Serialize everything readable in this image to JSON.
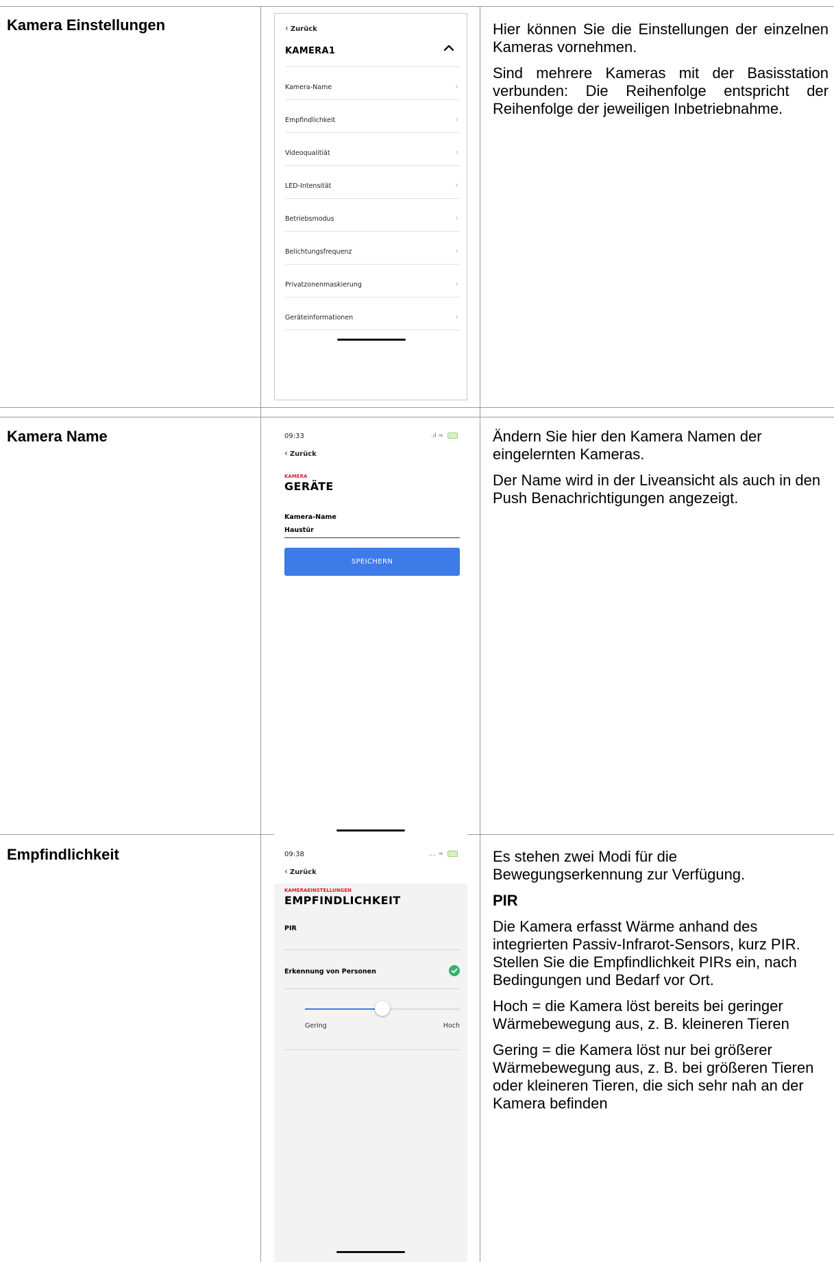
{
  "rows": [
    {
      "feature": "Kamera Einstellungen",
      "description": [
        "Hier können Sie die Einstellungen der einzelnen Kameras vornehmen.",
        "Sind mehrere Kameras mit der Basisstation verbunden: Die Reihenfolge entspricht der Reihenfolge der jeweiligen Inbetriebnahme."
      ],
      "screen": {
        "back_label": "Zurück",
        "title": "KAMERA1",
        "items": [
          "Kamera-Name",
          "Empfindlichkeit",
          "Videoqualitiät",
          "LED-Intensität",
          "Betriebsmodus",
          "Belichtungsfrequenz",
          "Privatzonenmaskierung",
          "Geräteinformationen"
        ]
      }
    },
    {
      "feature": "Kamera Name",
      "description": [
        "Ändern Sie hier den Kamera Namen der eingelernten Kameras.",
        "Der Name wird in der Liveansicht als auch in den Push Benachrichtigungen angezeigt."
      ],
      "screen": {
        "time": "09:33",
        "back_label": "Zurück",
        "kicker": "KAMERA",
        "title": "GERÄTE",
        "field_label": "Kamera-Name",
        "field_value": "Haustür",
        "button_label": "SPEICHERN"
      }
    },
    {
      "feature": "Empfindlichkeit",
      "description": [
        "Es stehen zwei Modi für die Bewegungserkennung zur Verfügung.",
        "PIR",
        "Die Kamera erfasst Wärme anhand des integrierten Passiv-Infrarot-Sensors, kurz PIR. Stellen Sie die Empfindlichkeit PIRs ein, nach Bedingungen und Bedarf vor Ort.",
        "Hoch = die Kamera löst bereits bei geringer Wärmebewegung aus, z. B. kleineren Tieren",
        "Gering = die Kamera löst nur bei größerer Wärmebewegung aus, z. B. bei größeren Tieren oder kleineren Tieren, die sich sehr nah an der Kamera befinden"
      ],
      "screen": {
        "time": "09:38",
        "back_label": "Zurück",
        "kicker": "KAMERAEINSTELLUNGEN",
        "title": "EMPFINDLICHKEIT",
        "option_pir": "PIR",
        "option_person": "Erkennung von Personen",
        "person_selected": true,
        "slider_value": 0.5,
        "slider_low": "Gering",
        "slider_high": "Hoch"
      }
    }
  ],
  "colors": {
    "accent_blue": "#3d7be8",
    "kicker_red": "#d21f2b",
    "check_green": "#36b26b"
  }
}
